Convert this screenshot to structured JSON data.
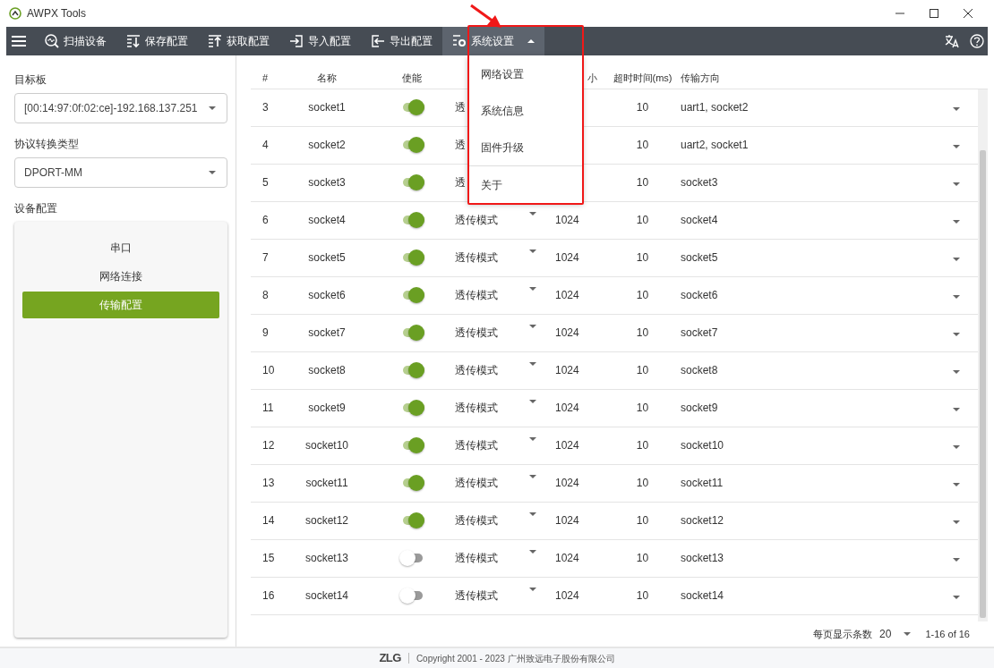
{
  "window": {
    "title": "AWPX Tools"
  },
  "toolbar": {
    "items": [
      {
        "kind": "scan",
        "label": "扫描设备"
      },
      {
        "kind": "save",
        "label": "保存配置"
      },
      {
        "kind": "fetch",
        "label": "获取配置"
      },
      {
        "kind": "import",
        "label": "导入配置"
      },
      {
        "kind": "export",
        "label": "导出配置"
      }
    ],
    "menu": {
      "label": "系统设置",
      "expanded": true,
      "items": [
        {
          "label": "网络设置",
          "divider_before": false
        },
        {
          "label": "系统信息",
          "divider_before": false
        },
        {
          "label": "固件升级",
          "divider_before": false
        },
        {
          "label": "关于",
          "divider_before": true
        }
      ]
    }
  },
  "sidebar": {
    "board_label": "目标板",
    "board_value": "[00:14:97:0f:02:ce]-192.168.137.251",
    "protocol_label": "协议转换类型",
    "protocol_value": "DPORT-MM",
    "config_label": "设备配置",
    "items": [
      {
        "label": "串口",
        "selected": false
      },
      {
        "label": "网络连接",
        "selected": false
      },
      {
        "label": "传输配置",
        "selected": true
      }
    ]
  },
  "table": {
    "columns": [
      "#",
      "名称",
      "使能",
      "小",
      "超时时间(ms)",
      "传输方向"
    ],
    "rows": [
      {
        "index": "3",
        "name": "socket1",
        "enabled": true,
        "mode": "透",
        "timeout": "10",
        "direction": "uart1, socket2"
      },
      {
        "index": "4",
        "name": "socket2",
        "enabled": true,
        "mode": "透",
        "timeout": "10",
        "direction": "uart2, socket1"
      },
      {
        "index": "5",
        "name": "socket3",
        "enabled": true,
        "mode": "透",
        "timeout": "10",
        "direction": "socket3"
      },
      {
        "index": "6",
        "name": "socket4",
        "enabled": true,
        "mode": "透传模式",
        "size": "1024",
        "timeout": "10",
        "direction": "socket4"
      },
      {
        "index": "7",
        "name": "socket5",
        "enabled": true,
        "mode": "透传模式",
        "size": "1024",
        "timeout": "10",
        "direction": "socket5"
      },
      {
        "index": "8",
        "name": "socket6",
        "enabled": true,
        "mode": "透传模式",
        "size": "1024",
        "timeout": "10",
        "direction": "socket6"
      },
      {
        "index": "9",
        "name": "socket7",
        "enabled": true,
        "mode": "透传模式",
        "size": "1024",
        "timeout": "10",
        "direction": "socket7"
      },
      {
        "index": "10",
        "name": "socket8",
        "enabled": true,
        "mode": "透传模式",
        "size": "1024",
        "timeout": "10",
        "direction": "socket8"
      },
      {
        "index": "11",
        "name": "socket9",
        "enabled": true,
        "mode": "透传模式",
        "size": "1024",
        "timeout": "10",
        "direction": "socket9"
      },
      {
        "index": "12",
        "name": "socket10",
        "enabled": true,
        "mode": "透传模式",
        "size": "1024",
        "timeout": "10",
        "direction": "socket10"
      },
      {
        "index": "13",
        "name": "socket11",
        "enabled": true,
        "mode": "透传模式",
        "size": "1024",
        "timeout": "10",
        "direction": "socket11"
      },
      {
        "index": "14",
        "name": "socket12",
        "enabled": true,
        "mode": "透传模式",
        "size": "1024",
        "timeout": "10",
        "direction": "socket12"
      },
      {
        "index": "15",
        "name": "socket13",
        "enabled": false,
        "mode": "透传模式",
        "size": "1024",
        "timeout": "10",
        "direction": "socket13"
      },
      {
        "index": "16",
        "name": "socket14",
        "enabled": false,
        "mode": "透传模式",
        "size": "1024",
        "timeout": "10",
        "direction": "socket14"
      }
    ]
  },
  "pagination": {
    "per_page_label": "每页显示条数",
    "per_page": "20",
    "range": "1-16 of 16"
  },
  "footer": {
    "logo": "ZLG",
    "copyright": "Copyright 2001 - 2023 广州致远电子股份有限公司"
  }
}
